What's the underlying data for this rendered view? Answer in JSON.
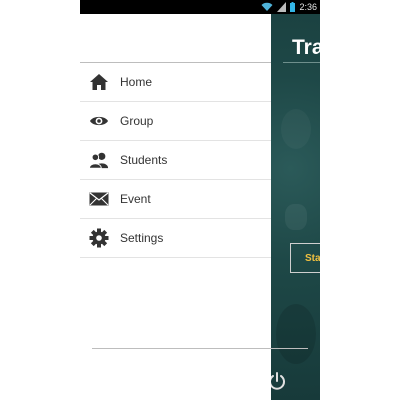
{
  "status_bar": {
    "time": "2:36",
    "icons": [
      "wifi-icon",
      "signal-icon",
      "battery-icon"
    ]
  },
  "app": {
    "title": "Tra",
    "start_button_label": "Sta",
    "accent_color": "#f0c040",
    "background_color": "#1e4847"
  },
  "menu": {
    "items": [
      {
        "label": "Home",
        "icon": "home-icon"
      },
      {
        "label": "Group",
        "icon": "eye-icon"
      },
      {
        "label": "Students",
        "icon": "students-icon"
      },
      {
        "label": "Event",
        "icon": "envelope-icon"
      },
      {
        "label": "Settings",
        "icon": "gear-icon"
      }
    ]
  },
  "footer": {
    "icon": "power-icon"
  }
}
